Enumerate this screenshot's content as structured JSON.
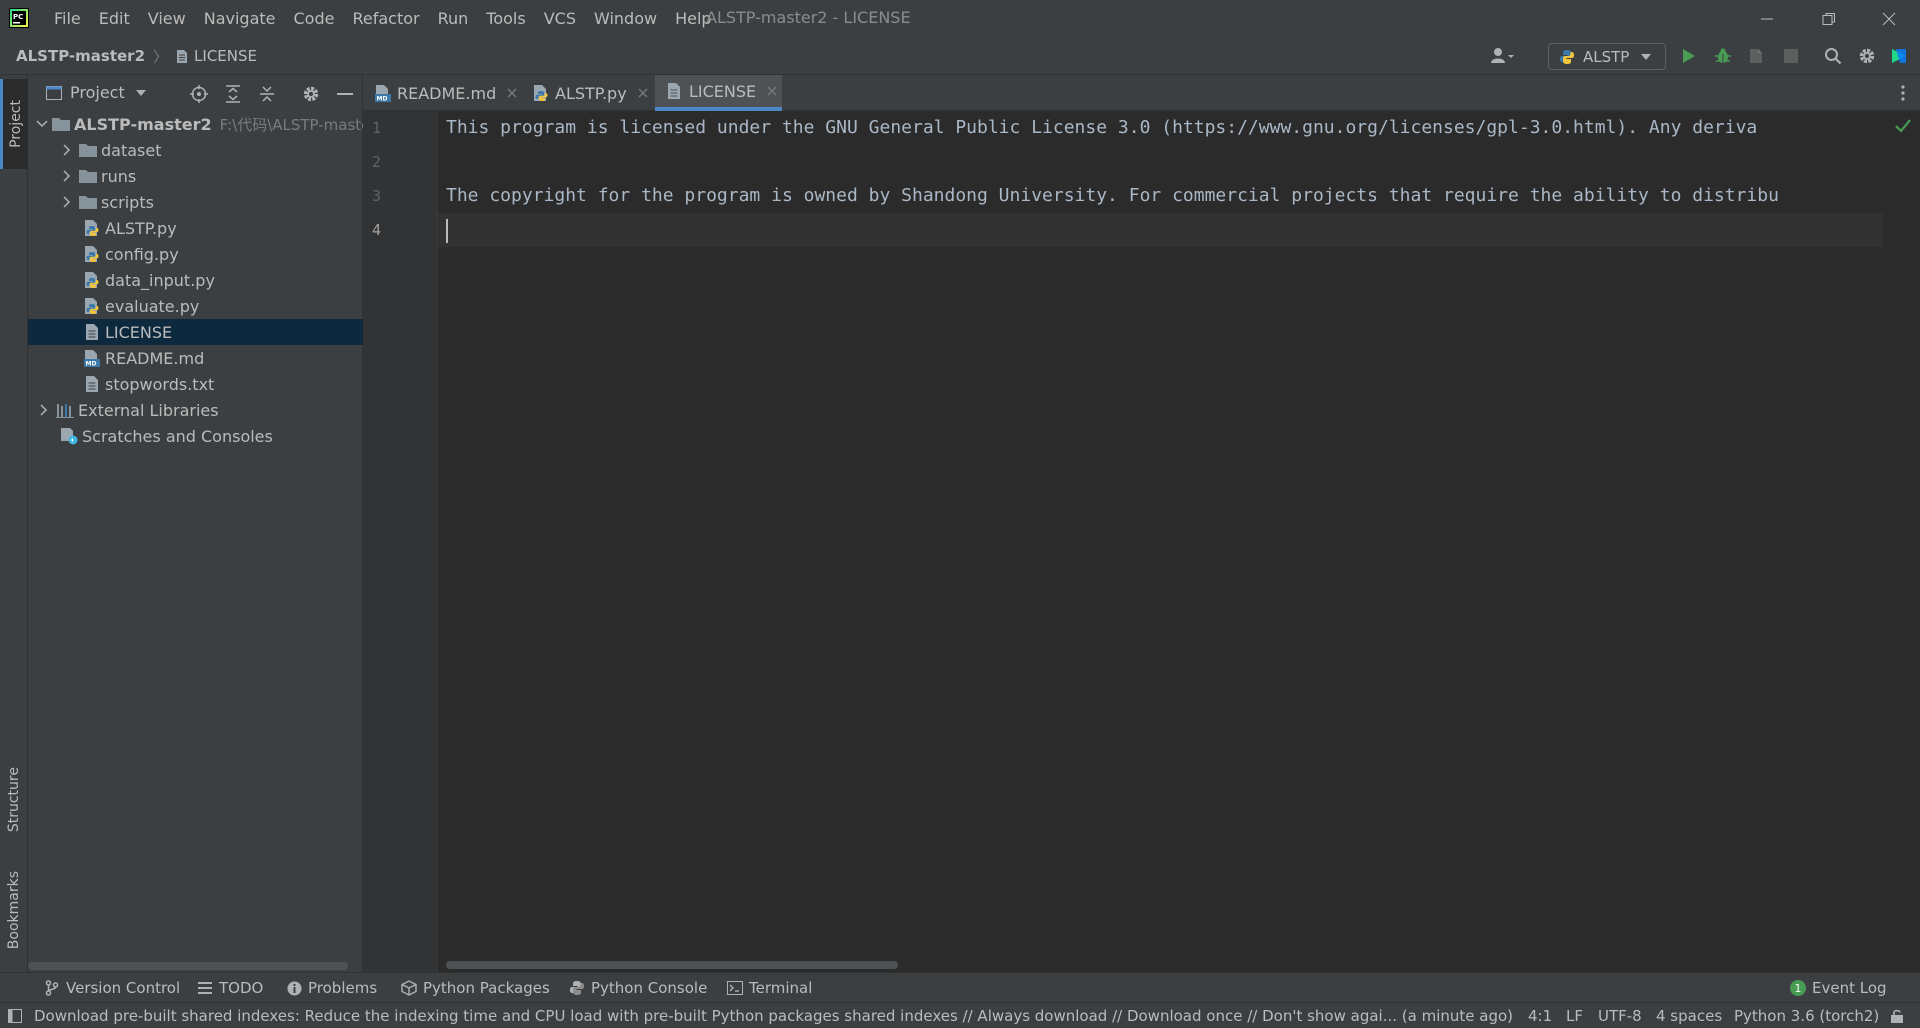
{
  "app": {
    "window_title": "ALSTP-master2 - LICENSE",
    "menu": [
      "File",
      "Edit",
      "View",
      "Navigate",
      "Code",
      "Refactor",
      "Run",
      "Tools",
      "VCS",
      "Window",
      "Help"
    ]
  },
  "navbar": {
    "project": "ALSTP-master2",
    "file": "LICENSE",
    "run_config": "ALSTP"
  },
  "left_stripe": {
    "project": "Project",
    "structure": "Structure",
    "bookmarks": "Bookmarks"
  },
  "project_panel": {
    "title": "Project",
    "tree": [
      {
        "label": "ALSTP-master2",
        "path": "F:\\代码\\ALSTP-master",
        "icon": "folder-icon"
      },
      {
        "label": "dataset",
        "icon": "folder-icon"
      },
      {
        "label": "runs",
        "icon": "folder-icon"
      },
      {
        "label": "scripts",
        "icon": "folder-icon"
      },
      {
        "label": "ALSTP.py",
        "icon": "python-file-icon"
      },
      {
        "label": "config.py",
        "icon": "python-file-icon"
      },
      {
        "label": "data_input.py",
        "icon": "python-file-icon"
      },
      {
        "label": "evaluate.py",
        "icon": "python-file-icon"
      },
      {
        "label": "LICENSE",
        "icon": "text-file-icon"
      },
      {
        "label": "README.md",
        "icon": "markdown-file-icon"
      },
      {
        "label": "stopwords.txt",
        "icon": "text-file-icon"
      },
      {
        "label": "External Libraries",
        "icon": "library-icon"
      },
      {
        "label": "Scratches and Consoles",
        "icon": "scratches-icon"
      }
    ]
  },
  "editor_tabs": [
    {
      "label": "README.md",
      "icon": "markdown-file-icon"
    },
    {
      "label": "ALSTP.py",
      "icon": "python-file-icon"
    },
    {
      "label": "LICENSE",
      "icon": "text-file-icon",
      "active": true
    }
  ],
  "editor": {
    "line_numbers": [
      "1",
      "2",
      "3",
      "4"
    ],
    "lines": [
      "This program is licensed under the GNU General Public License 3.0 (https://www.gnu.org/licenses/gpl-3.0.html). Any deriva",
      "",
      "The copyright for the program is owned by Shandong University. For commercial projects that require the ability to distribu",
      ""
    ]
  },
  "bottom_tabs": [
    "Version Control",
    "TODO",
    "Problems",
    "Python Packages",
    "Python Console",
    "Terminal"
  ],
  "event_log": {
    "label": "Event Log",
    "count": "1"
  },
  "statusbar": {
    "message": "Download pre-built shared indexes: Reduce the indexing time and CPU load with pre-built Python packages shared indexes // Always download // Download once // Don't show agai... (a minute ago)",
    "position": "4:1",
    "line_sep": "LF",
    "encoding": "UTF-8",
    "indent": "4 spaces",
    "interpreter": "Python 3.6 (torch2)"
  },
  "colors": {
    "accent": "#4a88c7",
    "background": "#2b2b2b",
    "panel": "#3c3f41",
    "run_green": "#499c54",
    "selection": "#0d293e"
  }
}
